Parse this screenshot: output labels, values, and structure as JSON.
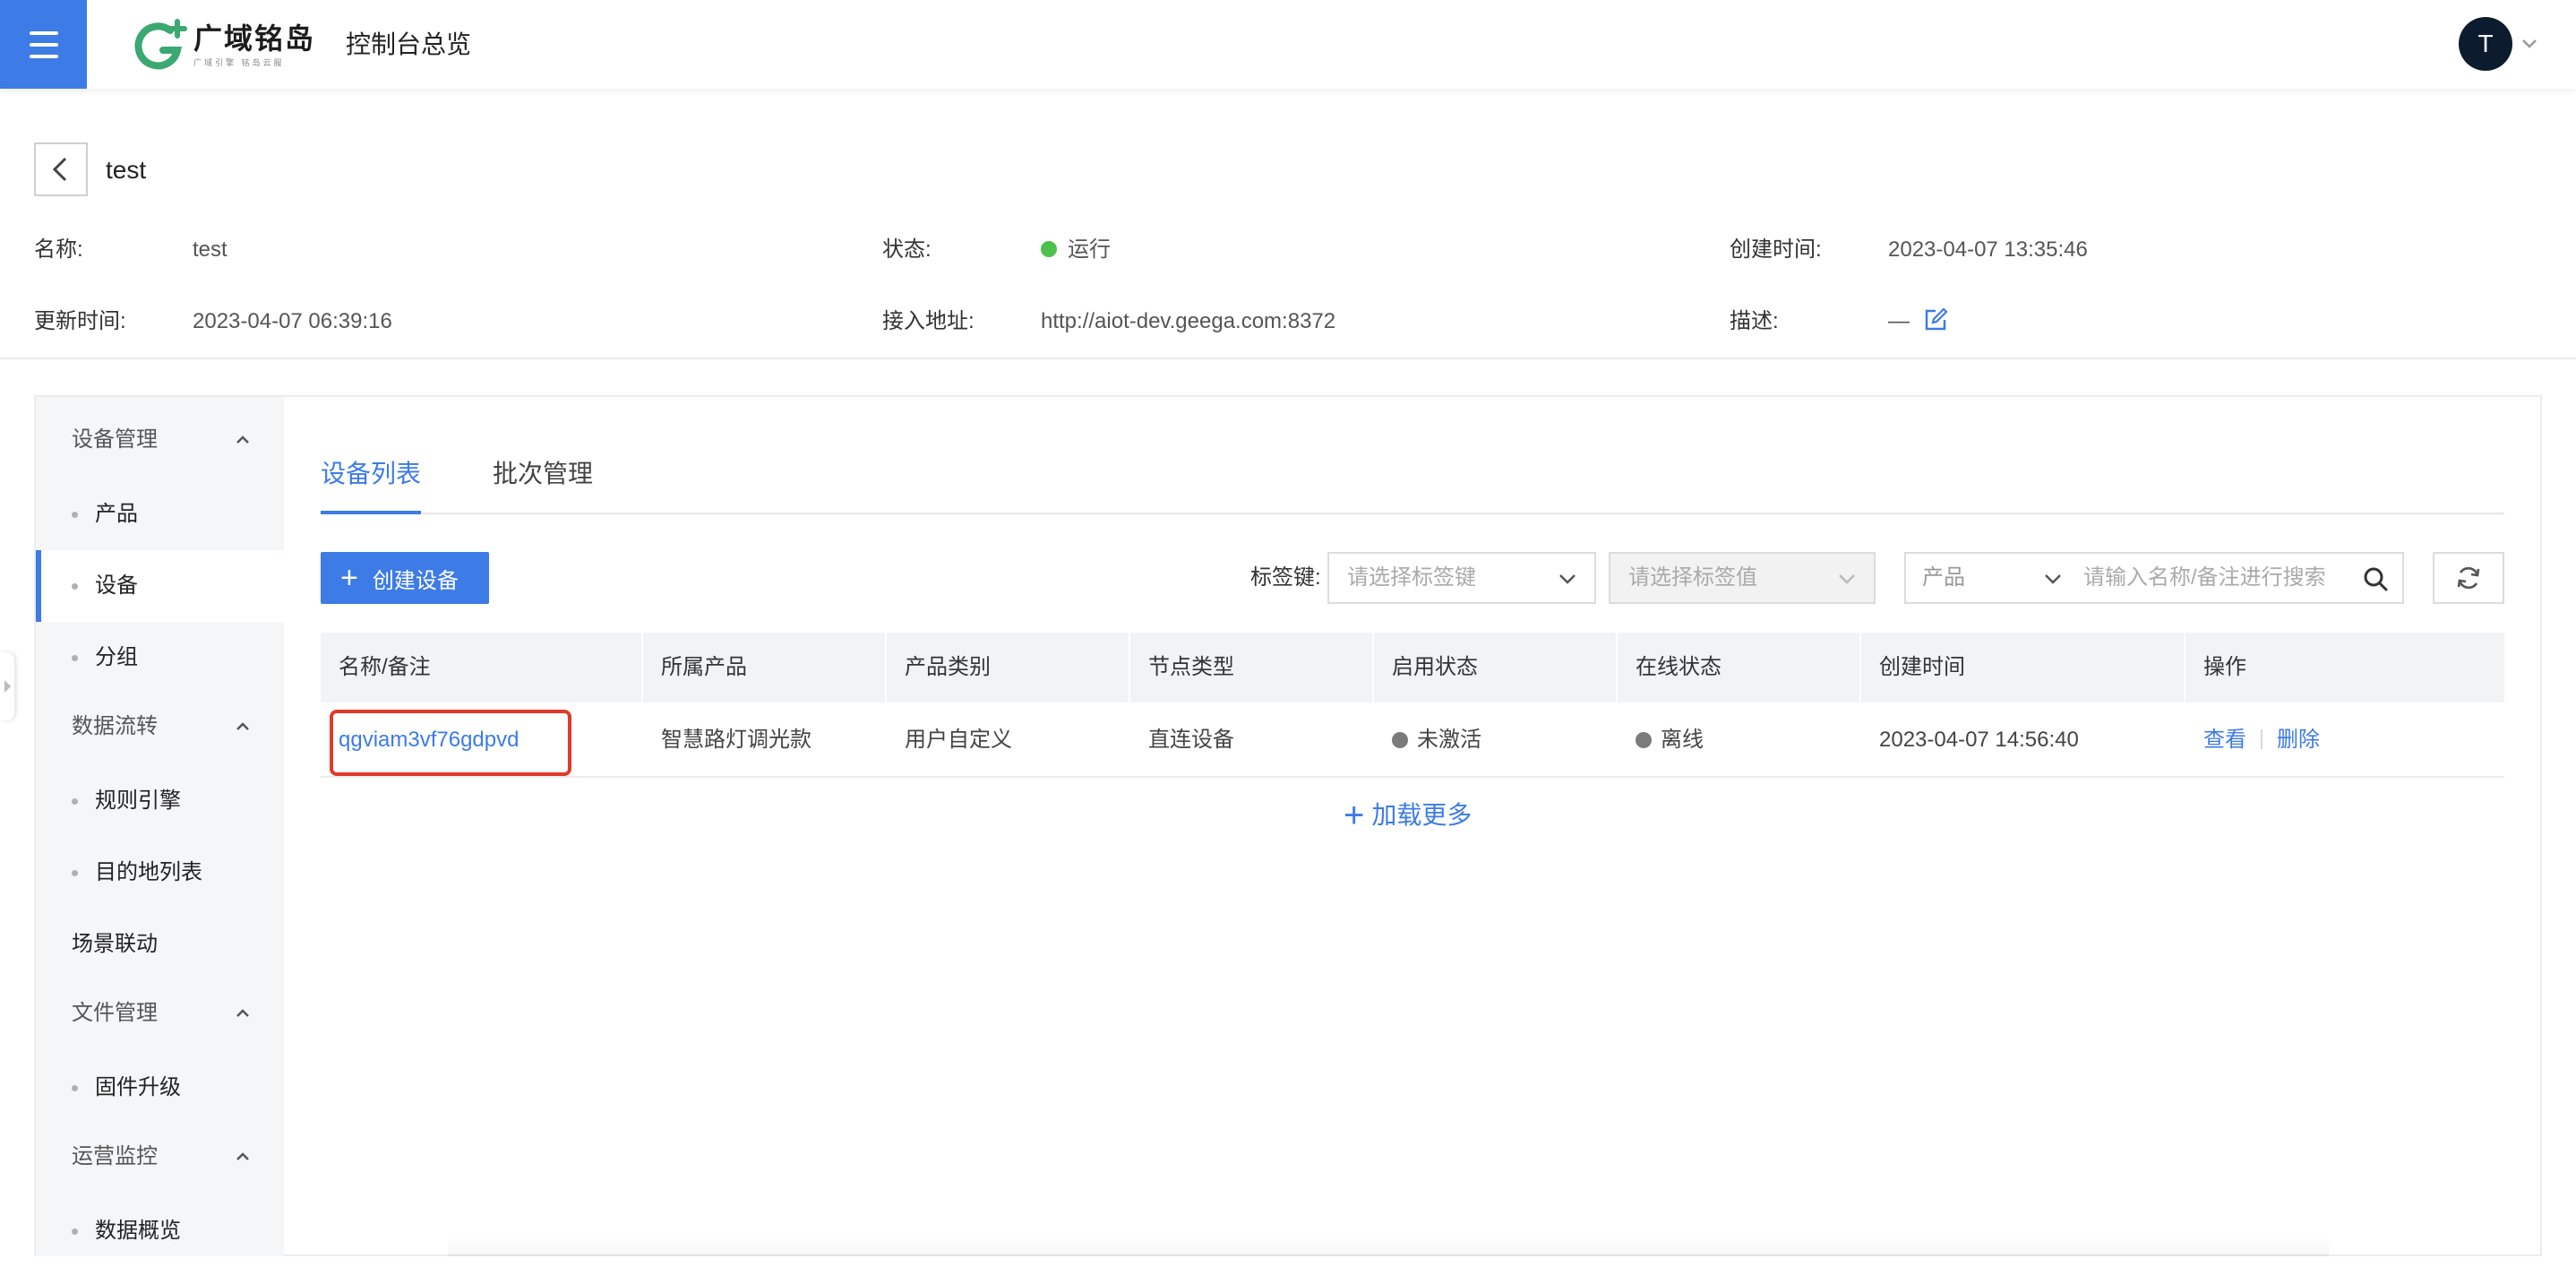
{
  "header": {
    "logo_title": "广域铭岛",
    "logo_subtitle": "广域引擎 铭岛云服",
    "console_title": "控制台总览",
    "avatar_initial": "T"
  },
  "detail": {
    "title": "test",
    "fields": {
      "name_label": "名称:",
      "name_value": "test",
      "status_label": "状态:",
      "status_value": "运行",
      "created_label": "创建时间:",
      "created_value": "2023-04-07 13:35:46",
      "updated_label": "更新时间:",
      "updated_value": "2023-04-07 06:39:16",
      "endpoint_label": "接入地址:",
      "endpoint_value": "http://aiot-dev.geega.com:8372",
      "desc_label": "描述:",
      "desc_value": "—"
    },
    "status_color": "#4cc14c"
  },
  "sidebar": {
    "groups": [
      {
        "label": "设备管理",
        "items": [
          "产品",
          "设备",
          "分组"
        ]
      },
      {
        "label": "数据流转",
        "items": [
          "规则引擎",
          "目的地列表"
        ]
      },
      {
        "label": "场景联动",
        "items": []
      },
      {
        "label": "文件管理",
        "items": [
          "固件升级"
        ]
      },
      {
        "label": "运营监控",
        "items": [
          "数据概览"
        ]
      }
    ],
    "active_item": "设备"
  },
  "tabs": [
    {
      "label": "设备列表",
      "active": true
    },
    {
      "label": "批次管理",
      "active": false
    }
  ],
  "toolbar": {
    "create_label": "创建设备",
    "tag_key_label": "标签键:",
    "tag_key_placeholder": "请选择标签键",
    "tag_value_placeholder": "请选择标签值",
    "product_select": "产品",
    "search_placeholder": "请输入名称/备注进行搜索"
  },
  "table": {
    "columns": [
      "名称/备注",
      "所属产品",
      "产品类别",
      "节点类型",
      "启用状态",
      "在线状态",
      "创建时间",
      "操作"
    ],
    "rows": [
      {
        "name": "qgviam3vf76gdpvd",
        "product": "智慧路灯调光款",
        "category": "用户自定义",
        "node_type": "直连设备",
        "enable_status": "未激活",
        "online_status": "离线",
        "created": "2023-04-07 14:56:40",
        "actions": [
          "查看",
          "删除"
        ]
      }
    ],
    "load_more": "加载更多"
  },
  "colors": {
    "primary": "#3d7be6",
    "highlight": "#e03a2b",
    "inactive_dot": "#7b7b7b"
  }
}
